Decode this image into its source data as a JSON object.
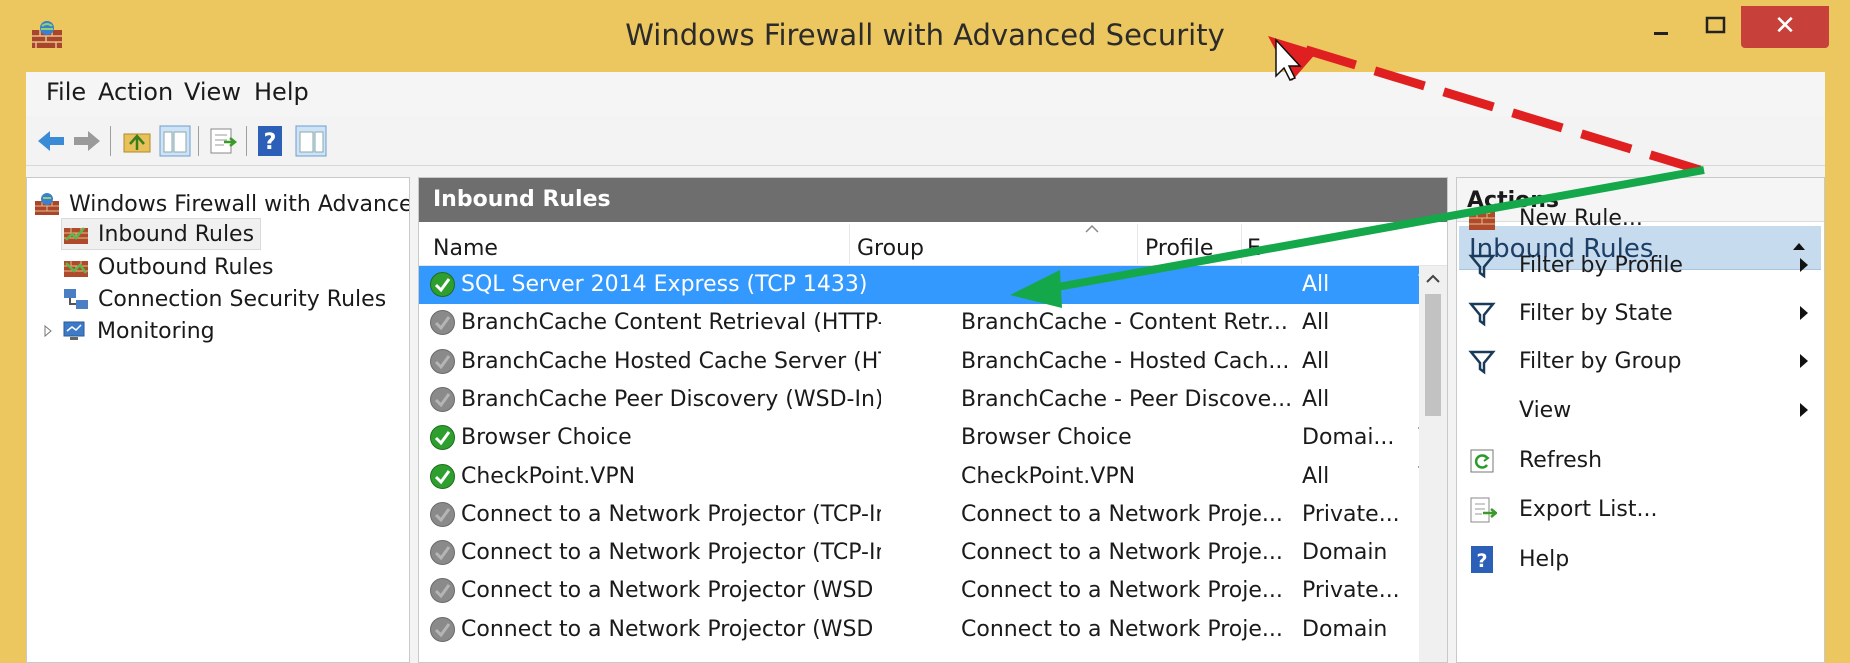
{
  "window": {
    "title": "Windows Firewall with Advanced Security",
    "minimize_icon": "minimize-icon",
    "maximize_icon": "maximize-icon",
    "close_glyph": "✕"
  },
  "menu": [
    "File",
    "Action",
    "View",
    "Help"
  ],
  "tree": {
    "root": "Windows Firewall with Advanced Security",
    "items": [
      "Inbound Rules",
      "Outbound Rules",
      "Connection Security Rules",
      "Monitoring"
    ]
  },
  "center": {
    "title": "Inbound Rules",
    "columns": {
      "name": "Name",
      "group": "Group",
      "profile": "Profile",
      "enabled": "E"
    },
    "rows": [
      {
        "name": "SQL Server 2014 Express (TCP 1433)",
        "group": "",
        "profile": "All",
        "enabled": "Y",
        "status": "enabled",
        "selected": true
      },
      {
        "name": "BranchCache Content Retrieval (HTTP-In)",
        "group": "BranchCache - Content Retr...",
        "profile": "All",
        "enabled": "N",
        "status": "disabled"
      },
      {
        "name": "BranchCache Hosted Cache Server (HTT...",
        "group": "BranchCache - Hosted Cach...",
        "profile": "All",
        "enabled": "N",
        "status": "disabled"
      },
      {
        "name": "BranchCache Peer Discovery (WSD-In)",
        "group": "BranchCache - Peer Discove...",
        "profile": "All",
        "enabled": "N",
        "status": "disabled"
      },
      {
        "name": "Browser Choice",
        "group": "Browser Choice",
        "profile": "Domai...",
        "enabled": "Y",
        "status": "enabled"
      },
      {
        "name": "CheckPoint.VPN",
        "group": "CheckPoint.VPN",
        "profile": "All",
        "enabled": "Y",
        "status": "enabled"
      },
      {
        "name": "Connect to a Network Projector (TCP-In)",
        "group": "Connect to a Network Proje...",
        "profile": "Private...",
        "enabled": "N",
        "status": "disabled"
      },
      {
        "name": "Connect to a Network Projector (TCP-In)",
        "group": "Connect to a Network Proje...",
        "profile": "Domain",
        "enabled": "N",
        "status": "disabled"
      },
      {
        "name": "Connect to a Network Projector (WSD Ev...",
        "group": "Connect to a Network Proje...",
        "profile": "Private...",
        "enabled": "N",
        "status": "disabled"
      },
      {
        "name": "Connect to a Network Projector (WSD Ev...",
        "group": "Connect to a Network Proje...",
        "profile": "Domain",
        "enabled": "N",
        "status": "disabled"
      }
    ]
  },
  "actions": {
    "title": "Actions",
    "section": "Inbound Rules",
    "items": [
      {
        "label": "New Rule...",
        "icon": "new-rule-icon",
        "submenu": false
      },
      {
        "label": "Filter by Profile",
        "icon": "filter-icon",
        "submenu": true
      },
      {
        "label": "Filter by State",
        "icon": "filter-icon",
        "submenu": true
      },
      {
        "label": "Filter by Group",
        "icon": "filter-icon",
        "submenu": true
      },
      {
        "label": "View",
        "icon": "",
        "submenu": true
      },
      {
        "label": "Refresh",
        "icon": "refresh-icon",
        "submenu": false
      },
      {
        "label": "Export List...",
        "icon": "export-icon",
        "submenu": false
      },
      {
        "label": "Help",
        "icon": "help-icon",
        "submenu": false
      }
    ]
  },
  "colors": {
    "titlebar": "#ecc65e",
    "selection": "#3399ff",
    "enabled_icon": "#2e9e2e",
    "disabled_icon": "#8a8a8a",
    "annotation_red": "#e02020",
    "annotation_green": "#14a84a"
  }
}
